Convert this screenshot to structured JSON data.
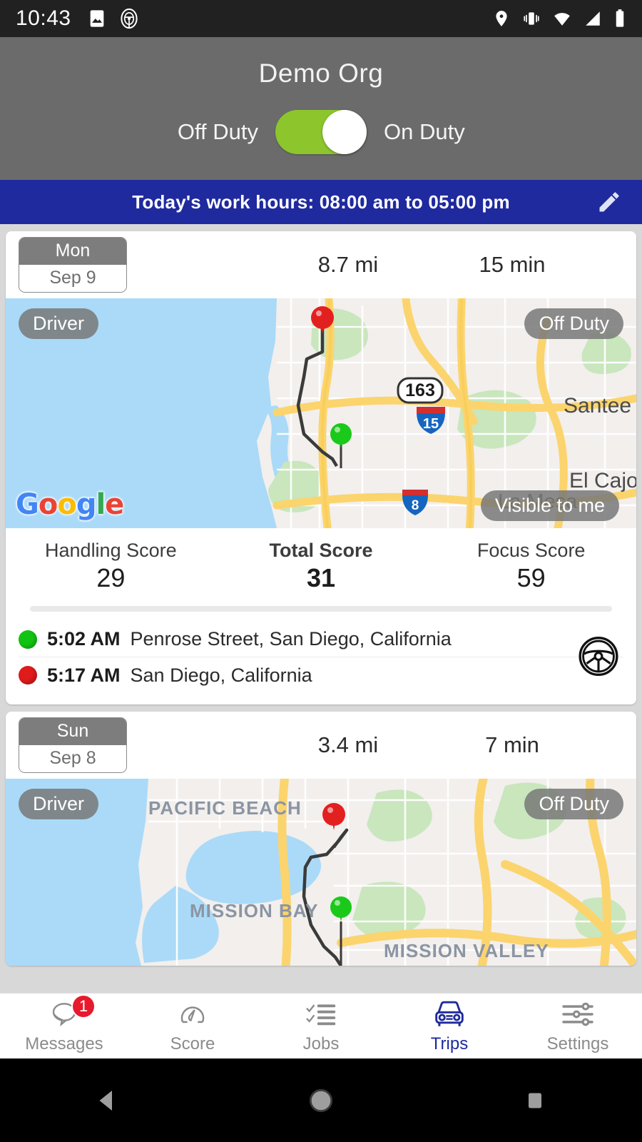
{
  "status_bar": {
    "time": "10:43",
    "left_icons": [
      "image-icon",
      "steering-wheel-icon"
    ],
    "right_icons": [
      "location-icon",
      "vibrate-icon",
      "wifi-icon",
      "signal-icon",
      "battery-icon"
    ]
  },
  "header": {
    "org_title": "Demo Org",
    "toggle": {
      "left_label": "Off Duty",
      "right_label": "On Duty",
      "state": "Off Duty",
      "track_color": "#8cc62c",
      "knob_color": "#ffffff"
    },
    "background_color": "#6b6b6b"
  },
  "work_hours_bar": {
    "text": "Today's work hours: 08:00 am to 05:00 pm",
    "edit_icon": "pencil-icon",
    "background_color": "#1f2a9e"
  },
  "trips": [
    {
      "day_of_week": "Mon",
      "date": "Sep 9",
      "distance": "8.7 mi",
      "duration": "15 min",
      "map": {
        "role_badge": "Driver",
        "duty_badge": "Off Duty",
        "visibility_badge": "Visible to me",
        "attribution": "Google",
        "labels": [
          "Santee",
          "El Cajon",
          "La Mesa"
        ],
        "highway_shields": [
          "163",
          "15",
          "8"
        ]
      },
      "scores": {
        "handling_label": "Handling Score",
        "handling_value": "29",
        "total_label": "Total Score",
        "total_value": "31",
        "focus_label": "Focus Score",
        "focus_value": "59"
      },
      "stops": [
        {
          "time": "5:02 AM",
          "address": "Penrose Street, San Diego, California",
          "type": "start"
        },
        {
          "time": "5:17 AM",
          "address": "San Diego, California",
          "type": "end"
        }
      ],
      "trip_icon": "steering-wheel-icon"
    },
    {
      "day_of_week": "Sun",
      "date": "Sep 8",
      "distance": "3.4 mi",
      "duration": "7 min",
      "map": {
        "role_badge": "Driver",
        "duty_badge": "Off Duty",
        "labels": [
          "PACIFIC BEACH",
          "MISSION BAY",
          "MISSION VALLEY"
        ]
      }
    }
  ],
  "bottom_nav": {
    "items": [
      {
        "label": "Messages",
        "icon": "chat-bubble-icon",
        "badge": "1",
        "active": false
      },
      {
        "label": "Score",
        "icon": "speedometer-icon",
        "active": false
      },
      {
        "label": "Jobs",
        "icon": "checklist-icon",
        "active": false
      },
      {
        "label": "Trips",
        "icon": "car-icon",
        "active": true
      },
      {
        "label": "Settings",
        "icon": "sliders-icon",
        "active": false
      }
    ],
    "active_color": "#1f2a9e",
    "inactive_color": "#8b8b8b"
  },
  "android_nav": {
    "buttons": [
      "back-button",
      "home-button",
      "recents-button"
    ]
  }
}
